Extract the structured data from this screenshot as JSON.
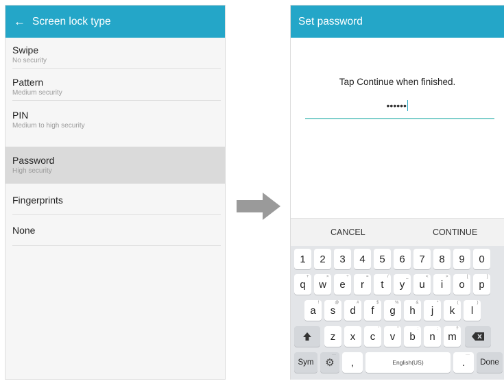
{
  "left": {
    "header_title": "Screen lock type",
    "options": [
      {
        "title": "Swipe",
        "subtitle": "No security"
      },
      {
        "title": "Pattern",
        "subtitle": "Medium security"
      },
      {
        "title": "PIN",
        "subtitle": "Medium to high security"
      },
      {
        "title": "Password",
        "subtitle": "High security",
        "selected": true
      },
      {
        "title": "Fingerprints",
        "subtitle": ""
      },
      {
        "title": "None",
        "subtitle": ""
      }
    ]
  },
  "right": {
    "header_title": "Set password",
    "instruction": "Tap Continue when finished.",
    "password_masked": "••••••",
    "cancel_label": "CANCEL",
    "continue_label": "CONTINUE"
  },
  "keyboard": {
    "numbers": [
      "1",
      "2",
      "3",
      "4",
      "5",
      "6",
      "7",
      "8",
      "9",
      "0"
    ],
    "row1": [
      "q",
      "w",
      "e",
      "r",
      "t",
      "y",
      "u",
      "i",
      "o",
      "p"
    ],
    "row1_hints": [
      "+",
      "×",
      "÷",
      "=",
      "/",
      "_",
      "<",
      ">",
      "[",
      "]"
    ],
    "row2": [
      "a",
      "s",
      "d",
      "f",
      "g",
      "h",
      "j",
      "k",
      "l"
    ],
    "row2_hints": [
      "!",
      "@",
      "#",
      "$",
      "%",
      "&",
      "*",
      "(",
      ")"
    ],
    "row3": [
      "z",
      "x",
      "c",
      "v",
      "b",
      "n",
      "m"
    ],
    "row3_hints": [
      "",
      "",
      "'",
      "\"",
      ":",
      ";",
      "?"
    ],
    "sym_label": "Sym",
    "comma_label": ",",
    "space_label": "English(US)",
    "period_label": ".",
    "done_label": "Done",
    "settings_hint": "···",
    "period_hint": "···"
  },
  "colors": {
    "header": "#24a6c8",
    "selected_row": "#dadada",
    "password_line": "#7fcfcc",
    "arrow": "#9a9a9a"
  }
}
